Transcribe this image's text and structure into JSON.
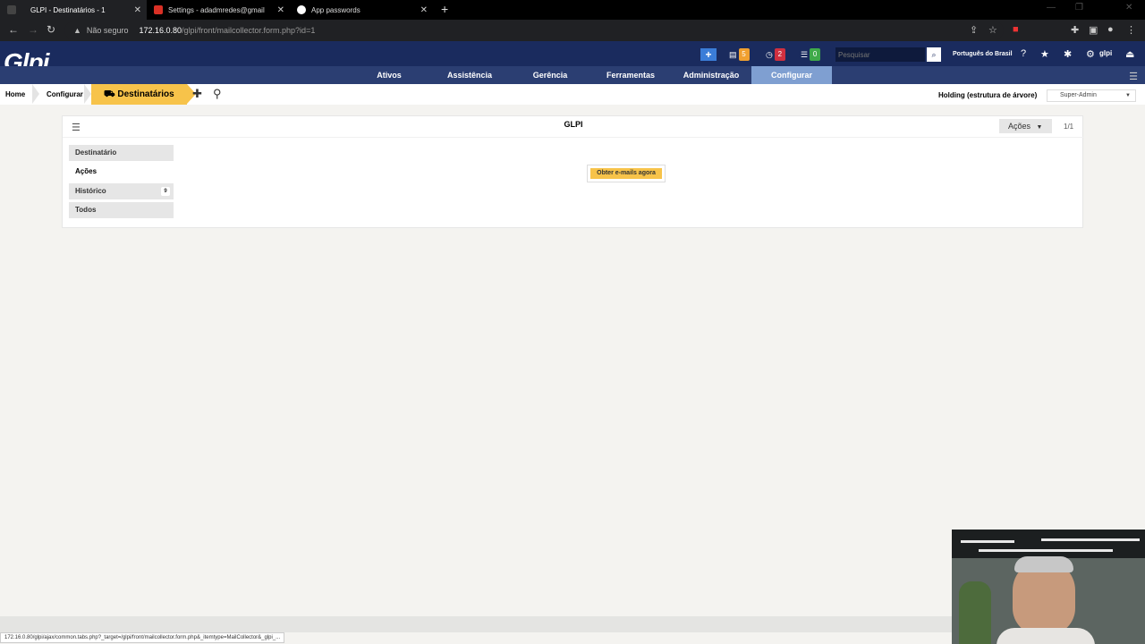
{
  "browser": {
    "tabs": [
      {
        "title": "GLPI - Destinatários - 1",
        "active": true
      },
      {
        "title": "Settings - adadmredes@gmail",
        "active": false
      },
      {
        "title": "App passwords",
        "active": false
      }
    ],
    "insecure_label": "Não seguro",
    "url_host": "172.16.0.80",
    "url_path": "/glpi/front/mailcollector.form.php?id=1"
  },
  "header": {
    "logo": "Glpi",
    "badges": [
      {
        "icon": "folder-icon",
        "count": "5",
        "color": "#f0a030"
      },
      {
        "icon": "clock-icon",
        "count": "2",
        "color": "#d03040"
      },
      {
        "icon": "list-icon",
        "count": "0",
        "color": "#3faa4a"
      }
    ],
    "search_placeholder": "Pesquisar",
    "language": "Português do Brasil",
    "user": "glpi"
  },
  "menu": {
    "items": [
      "Ativos",
      "Assistência",
      "Gerência",
      "Ferramentas",
      "Administração",
      "Configurar"
    ],
    "active": "Configurar"
  },
  "breadcrumb": {
    "home": "Home",
    "parent": "Configurar",
    "current": "Destinatários"
  },
  "entity": "Holding (estrutura de árvore)",
  "profile": "Super-Admin",
  "panel": {
    "title": "GLPI",
    "actions_label": "Ações",
    "pager": "1/1",
    "tabs": [
      {
        "label": "Destinatário",
        "count": ""
      },
      {
        "label": "Ações",
        "count": ""
      },
      {
        "label": "Histórico",
        "count": "9"
      },
      {
        "label": "Todos",
        "count": ""
      }
    ],
    "selected_tab": "Ações",
    "fetch_button": "Obter e-mails agora"
  },
  "status_url": "172.16.0.80/glpi/ajax/common.tabs.php?_target=/glpi/front/mailcollector.form.php&_itemtype=MailCollector&_glpi_..."
}
